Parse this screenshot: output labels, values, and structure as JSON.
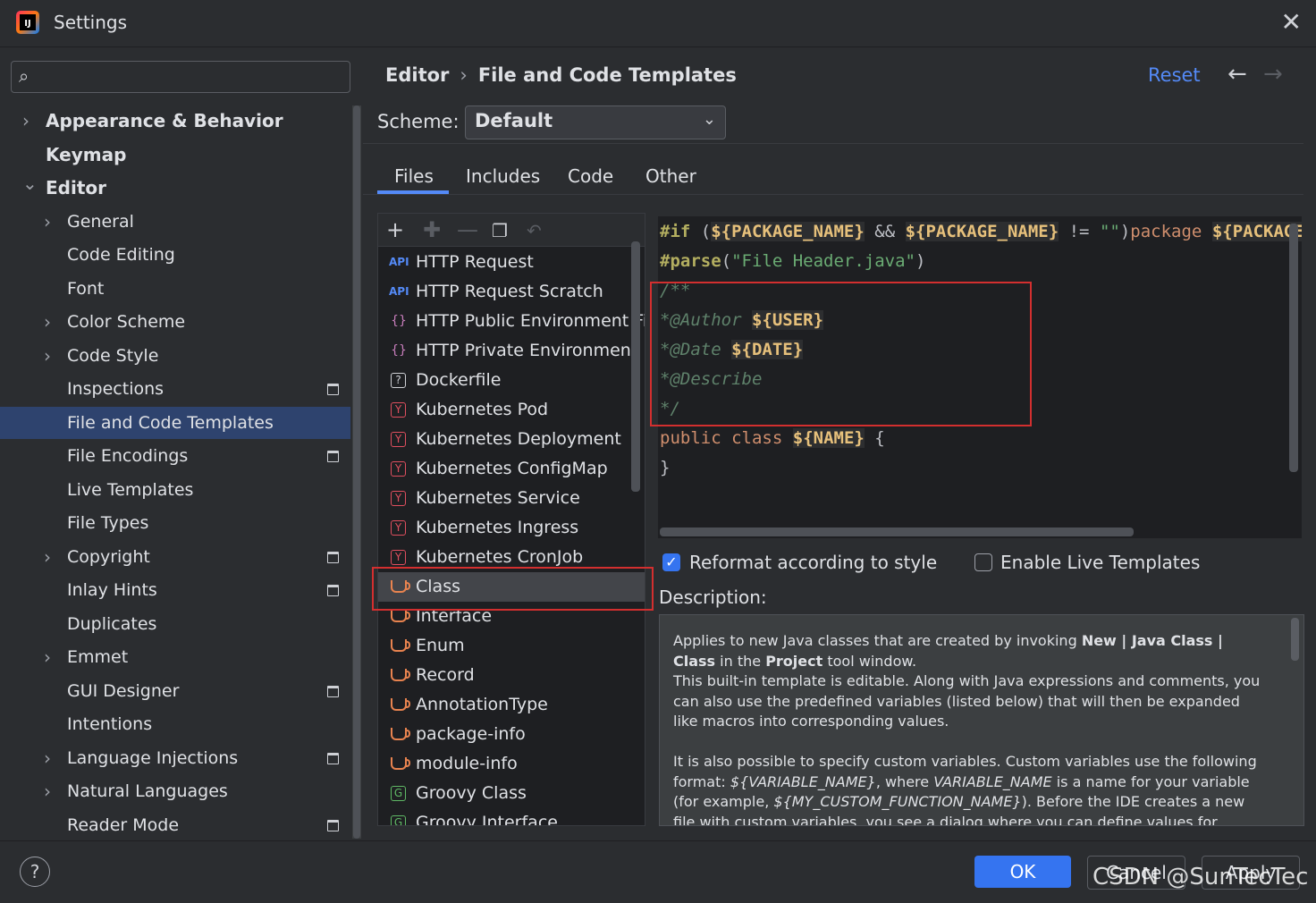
{
  "window": {
    "title": "Settings"
  },
  "search": {
    "placeholder": ""
  },
  "sidebar": {
    "items": [
      {
        "label": "Appearance & Behavior",
        "level": 0,
        "expandable": true,
        "expanded": false,
        "bold": true
      },
      {
        "label": "Keymap",
        "level": 0,
        "expandable": false,
        "bold": true
      },
      {
        "label": "Editor",
        "level": 0,
        "expandable": true,
        "expanded": true,
        "bold": true
      },
      {
        "label": "General",
        "level": 1,
        "expandable": true
      },
      {
        "label": "Code Editing",
        "level": 1
      },
      {
        "label": "Font",
        "level": 1
      },
      {
        "label": "Color Scheme",
        "level": 1,
        "expandable": true
      },
      {
        "label": "Code Style",
        "level": 1,
        "expandable": true
      },
      {
        "label": "Inspections",
        "level": 1,
        "pinned": true
      },
      {
        "label": "File and Code Templates",
        "level": 1,
        "selected": true
      },
      {
        "label": "File Encodings",
        "level": 1,
        "pinned": true
      },
      {
        "label": "Live Templates",
        "level": 1
      },
      {
        "label": "File Types",
        "level": 1
      },
      {
        "label": "Copyright",
        "level": 1,
        "expandable": true,
        "pinned": true
      },
      {
        "label": "Inlay Hints",
        "level": 1,
        "pinned": true
      },
      {
        "label": "Duplicates",
        "level": 1
      },
      {
        "label": "Emmet",
        "level": 1,
        "expandable": true
      },
      {
        "label": "GUI Designer",
        "level": 1,
        "pinned": true
      },
      {
        "label": "Intentions",
        "level": 1
      },
      {
        "label": "Language Injections",
        "level": 1,
        "expandable": true,
        "pinned": true
      },
      {
        "label": "Natural Languages",
        "level": 1,
        "expandable": true
      },
      {
        "label": "Reader Mode",
        "level": 1,
        "pinned": true
      }
    ]
  },
  "header": {
    "breadcrumb": [
      "Editor",
      "File and Code Templates"
    ],
    "reset_label": "Reset"
  },
  "scheme": {
    "label": "Scheme:",
    "value": "Default"
  },
  "tabs": [
    {
      "label": "Files",
      "active": true
    },
    {
      "label": "Includes"
    },
    {
      "label": "Code"
    },
    {
      "label": "Other"
    }
  ],
  "templates": [
    {
      "label": "HTTP Request",
      "icon": "api-icon"
    },
    {
      "label": "HTTP Request Scratch",
      "icon": "api-icon"
    },
    {
      "label": "HTTP Public Environment File",
      "icon": "json-icon"
    },
    {
      "label": "HTTP Private Environment File",
      "icon": "json-icon"
    },
    {
      "label": "Dockerfile",
      "icon": "unknown-file-icon"
    },
    {
      "label": "Kubernetes Pod",
      "icon": "yaml-icon"
    },
    {
      "label": "Kubernetes Deployment",
      "icon": "yaml-icon"
    },
    {
      "label": "Kubernetes ConfigMap",
      "icon": "yaml-icon"
    },
    {
      "label": "Kubernetes Service",
      "icon": "yaml-icon"
    },
    {
      "label": "Kubernetes Ingress",
      "icon": "yaml-icon"
    },
    {
      "label": "Kubernetes CronJob",
      "icon": "yaml-icon"
    },
    {
      "label": "Class",
      "icon": "java-icon",
      "selected": true
    },
    {
      "label": "Interface",
      "icon": "java-icon"
    },
    {
      "label": "Enum",
      "icon": "java-icon"
    },
    {
      "label": "Record",
      "icon": "java-icon"
    },
    {
      "label": "AnnotationType",
      "icon": "java-icon"
    },
    {
      "label": "package-info",
      "icon": "java-icon"
    },
    {
      "label": "module-info",
      "icon": "java-icon"
    },
    {
      "label": "Groovy Class",
      "icon": "groovy-icon"
    },
    {
      "label": "Groovy Interface",
      "icon": "groovy-icon"
    }
  ],
  "code": {
    "line1": [
      {
        "t": "#if",
        "c": "dir"
      },
      {
        "t": " (",
        "c": "def"
      },
      {
        "t": "${PACKAGE_NAME}",
        "c": "var"
      },
      {
        "t": " && ",
        "c": "def"
      },
      {
        "t": "${PACKAGE_NAME}",
        "c": "var"
      },
      {
        "t": " != ",
        "c": "def"
      },
      {
        "t": "\"\"",
        "c": "str"
      },
      {
        "t": ")",
        "c": "def"
      },
      {
        "t": "package",
        "c": "kw"
      },
      {
        "t": " ",
        "c": "def"
      },
      {
        "t": "${PACKAGE_NAME}",
        "c": "var"
      },
      {
        "t": ";",
        "c": "def"
      }
    ],
    "line2": [
      {
        "t": "#parse",
        "c": "dir"
      },
      {
        "t": "(",
        "c": "def"
      },
      {
        "t": "\"File Header.java\"",
        "c": "str"
      },
      {
        "t": ")",
        "c": "def"
      }
    ],
    "line3": [
      {
        "t": "/**",
        "c": "cmt"
      }
    ],
    "line4": [
      {
        "t": "*@Author",
        "c": "cmt"
      },
      {
        "t": " ",
        "c": "def"
      },
      {
        "t": "${USER}",
        "c": "var"
      }
    ],
    "line5": [
      {
        "t": "*@Date",
        "c": "cmt"
      },
      {
        "t": " ",
        "c": "def"
      },
      {
        "t": "${DATE}",
        "c": "var"
      }
    ],
    "line6": [
      {
        "t": "*@Describe",
        "c": "cmt"
      }
    ],
    "line7": [
      {
        "t": "*/",
        "c": "cmt"
      }
    ],
    "line8": [
      {
        "t": "public",
        "c": "kw"
      },
      {
        "t": " ",
        "c": "def"
      },
      {
        "t": "class",
        "c": "kw"
      },
      {
        "t": " ",
        "c": "def"
      },
      {
        "t": "${NAME}",
        "c": "var"
      },
      {
        "t": " {",
        "c": "def"
      }
    ],
    "line9": [
      {
        "t": "}",
        "c": "def"
      }
    ]
  },
  "options": {
    "reformat_label": "Reformat according to style",
    "reformat_checked": true,
    "live_templates_label": "Enable Live Templates",
    "live_templates_checked": false
  },
  "description": {
    "label": "Description:",
    "p1_a": "Applies to new Java classes that are created by invoking ",
    "p1_b1": "New | Java Class | Class",
    "p1_c": " in the ",
    "p1_b2": "Project",
    "p1_d": " tool window.",
    "p2": "This built-in template is editable. Along with Java expressions and comments, you can also use the predefined variables (listed below) that will then be expanded like macros into corresponding values.",
    "p3_a": "It is also possible to specify custom variables. Custom variables use the following format: ",
    "p3_i1": "${VARIABLE_NAME}",
    "p3_b": ", where ",
    "p3_i2": "VARIABLE_NAME",
    "p3_c": " is a name for your variable (for example, ",
    "p3_i3": "${MY_CUSTOM_FUNCTION_NAME}",
    "p3_d": "). Before the IDE creates a new file with custom variables, you see a dialog where you can define values for custom variables in the template."
  },
  "buttons": {
    "ok": "OK",
    "cancel": "Cancel",
    "apply": "Apply",
    "help": "?"
  },
  "watermark": "CSDN @SunTecTec"
}
